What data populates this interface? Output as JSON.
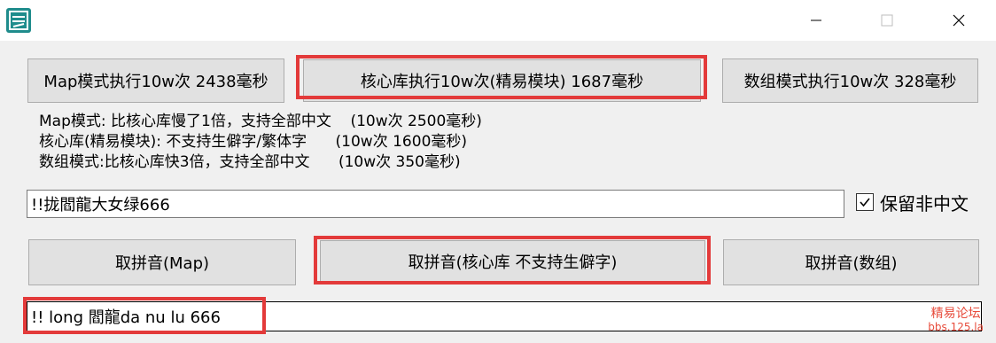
{
  "titlebar": {
    "minimize_icon": "minimize-icon",
    "maximize_icon": "maximize-icon",
    "close_icon": "close-icon"
  },
  "benchmark_buttons": {
    "map": "Map模式执行10w次  2438毫秒",
    "core": "核心库执行10w次(精易模块)  1687毫秒",
    "array": "数组模式执行10w次  328毫秒"
  },
  "description_lines": [
    "Map模式: 比核心库慢了1倍，支持全部中文    (10w次 2500毫秒)",
    "核心库(精易模块): 不支持生僻字/繁体字      (10w次 1600毫秒)",
    "数组模式:比核心库快3倍，支持全部中文      (10w次 350毫秒)"
  ],
  "input": {
    "value": "!!拢閻龍大女绿666"
  },
  "keep_non_chinese": {
    "label": "保留非中文",
    "checked": true
  },
  "pinyin_buttons": {
    "map": "取拼音(Map)",
    "core": "取拼音(核心库 不支持生僻字)",
    "array": "取拼音(数组)"
  },
  "output": {
    "value": "!! long 閻龍da nu lu 666"
  },
  "watermark": {
    "line1": "精易论坛",
    "line2": "bbs.125.la"
  },
  "colors": {
    "highlight": "#e33a3a",
    "watermark": "#e74c3c",
    "accent_icon": "#1f8c8c"
  }
}
